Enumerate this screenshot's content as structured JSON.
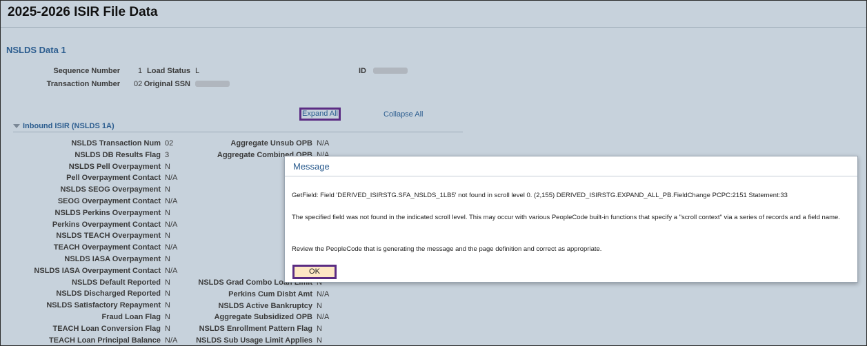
{
  "page": {
    "title": "2025-2026 ISIR File Data",
    "section_title": "NSLDS Data 1"
  },
  "header_fields": {
    "sequence_number": {
      "label": "Sequence Number",
      "value": "1"
    },
    "transaction_number": {
      "label": "Transaction Number",
      "value": "02"
    },
    "load_status": {
      "label": "Load Status",
      "value": "L"
    },
    "original_ssn": {
      "label": "Original SSN"
    },
    "id": {
      "label": "ID"
    }
  },
  "links": {
    "expand_all": "Expand All",
    "collapse_all": "Collapse All"
  },
  "inbound": {
    "label": "Inbound ISIR (NSLDS 1A)"
  },
  "left_rows": [
    {
      "label": "NSLDS Transaction Num",
      "value": "02"
    },
    {
      "label": "NSLDS DB Results Flag",
      "value": "3"
    },
    {
      "label": "NSLDS Pell Overpayment",
      "value": "N"
    },
    {
      "label": "Pell Overpayment Contact",
      "value": "N/A"
    },
    {
      "label": "NSLDS SEOG Overpayment",
      "value": "N"
    },
    {
      "label": "SEOG Overpayment Contact",
      "value": "N/A"
    },
    {
      "label": "NSLDS Perkins Overpayment",
      "value": "N"
    },
    {
      "label": "Perkins Overpayment Contact",
      "value": "N/A"
    },
    {
      "label": "NSLDS TEACH Overpayment",
      "value": "N"
    },
    {
      "label": "TEACH Overpayment Contact",
      "value": "N/A"
    },
    {
      "label": "NSLDS IASA Overpayment",
      "value": "N"
    },
    {
      "label": "NSLDS IASA Overpayment Contact",
      "value": "N/A"
    },
    {
      "label": "NSLDS Default Reported",
      "value": "N"
    },
    {
      "label": "NSLDS Discharged Reported",
      "value": "N"
    },
    {
      "label": "NSLDS Satisfactory Repayment",
      "value": "N"
    },
    {
      "label": "Fraud Loan Flag",
      "value": "N"
    },
    {
      "label": "TEACH Loan Conversion Flag",
      "value": "N"
    },
    {
      "label": "TEACH Loan Principal Balance",
      "value": "N/A"
    }
  ],
  "right_top": [
    {
      "label": "Aggregate Unsub OPB",
      "value": "N/A"
    },
    {
      "label": "Aggregate Combined OPB",
      "value": "N/A"
    }
  ],
  "right_bottom": [
    {
      "label": "NSLDS Grad Combo Loan Limit",
      "value": "N"
    },
    {
      "label": "Perkins Cum Disbt Amt",
      "value": "N/A"
    },
    {
      "label": "NSLDS Active Bankruptcy",
      "value": "N"
    },
    {
      "label": "Aggregate Subsidized OPB",
      "value": "N/A"
    },
    {
      "label": "NSLDS Enrollment Pattern Flag",
      "value": "N"
    },
    {
      "label": "NSLDS Sub Usage Limit Applies",
      "value": "N"
    }
  ],
  "dialog": {
    "title": "Message",
    "line1": "GetField: Field 'DERIVED_ISIRSTG.SFA_NSLDS_1LB5' not found in scroll level 0. (2,155) DERIVED_ISIRSTG.EXPAND_ALL_PB.FieldChange  PCPC:2151  Statement:33",
    "line2": "The specified field was not found in the indicated scroll level.  This may occur with various PeopleCode built-in functions that specify a \"scroll context\" via a series of records and a field name.",
    "line3": "Review the PeopleCode that is generating the message and the page definition and correct as appropriate.",
    "ok_label": "OK"
  },
  "colors": {
    "background": "#c7d2dc",
    "link": "#2c5d8f",
    "highlight": "#5b2c83",
    "ok_fill": "#fde7c4"
  }
}
